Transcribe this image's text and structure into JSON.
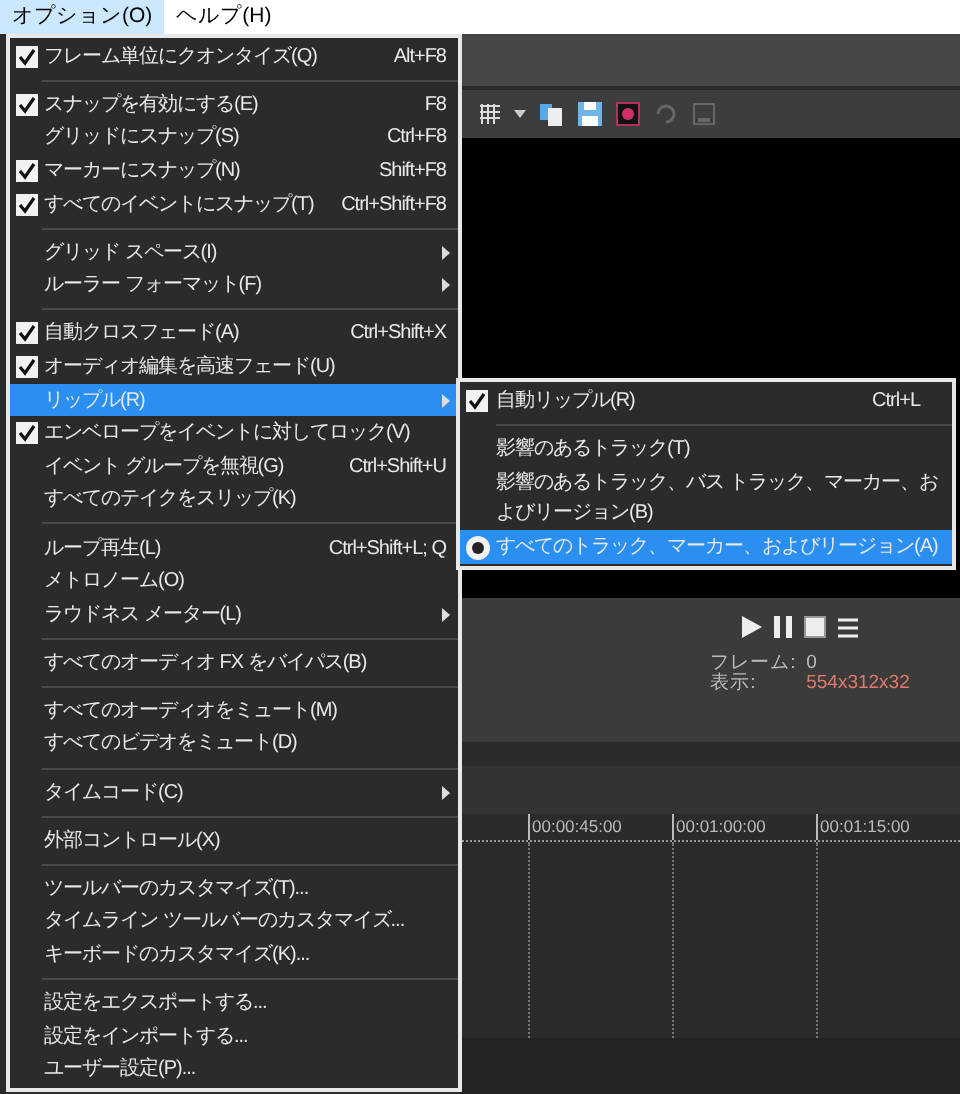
{
  "menubar": [
    {
      "label": "オプション(O)",
      "selected": true
    },
    {
      "label": "ヘルプ(H)",
      "selected": false
    }
  ],
  "menu": {
    "items": [
      {
        "kind": "item",
        "label": "フレーム単位にクオンタイズ(Q)",
        "shortcut": "Alt+F8",
        "checked": true,
        "highlighted": false
      },
      {
        "kind": "separator"
      },
      {
        "kind": "item",
        "label": "スナップを有効にする(E)",
        "shortcut": "F8",
        "checked": true,
        "highlighted": false
      },
      {
        "kind": "item",
        "label": "グリッドにスナップ(S)",
        "shortcut": "Ctrl+F8",
        "checked": false,
        "highlighted": false
      },
      {
        "kind": "item",
        "label": "マーカーにスナップ(N)",
        "shortcut": "Shift+F8",
        "checked": true,
        "highlighted": false
      },
      {
        "kind": "item",
        "label": "すべてのイベントにスナップ(T)",
        "shortcut": "Ctrl+Shift+F8",
        "checked": true,
        "highlighted": false
      },
      {
        "kind": "separator"
      },
      {
        "kind": "submenu",
        "label": "グリッド スペース(I)",
        "checked": false,
        "highlighted": false
      },
      {
        "kind": "submenu",
        "label": "ルーラー フォーマット(F)",
        "checked": false,
        "highlighted": false
      },
      {
        "kind": "separator"
      },
      {
        "kind": "item",
        "label": "自動クロスフェード(A)",
        "shortcut": "Ctrl+Shift+X",
        "checked": true,
        "highlighted": false
      },
      {
        "kind": "item",
        "label": "オーディオ編集を高速フェード(U)",
        "checked": true,
        "highlighted": false
      },
      {
        "kind": "submenu",
        "label": "リップル(R)",
        "checked": false,
        "highlighted": true
      },
      {
        "kind": "item",
        "label": "エンベロープをイベントに対してロック(V)",
        "checked": true,
        "highlighted": false
      },
      {
        "kind": "item",
        "label": "イベント グループを無視(G)",
        "shortcut": "Ctrl+Shift+U",
        "checked": false,
        "highlighted": false
      },
      {
        "kind": "item",
        "label": "すべてのテイクをスリップ(K)",
        "checked": false,
        "highlighted": false
      },
      {
        "kind": "separator"
      },
      {
        "kind": "item",
        "label": "ループ再生(L)",
        "shortcut": "Ctrl+Shift+L; Q",
        "checked": false,
        "highlighted": false
      },
      {
        "kind": "item",
        "label": "メトロノーム(O)",
        "checked": false,
        "highlighted": false
      },
      {
        "kind": "submenu",
        "label": "ラウドネス メーター(L)",
        "checked": false,
        "highlighted": false
      },
      {
        "kind": "separator"
      },
      {
        "kind": "item",
        "label": "すべてのオーディオ FX をバイパス(B)",
        "checked": false,
        "highlighted": false
      },
      {
        "kind": "separator"
      },
      {
        "kind": "item",
        "label": "すべてのオーディオをミュート(M)",
        "checked": false,
        "highlighted": false
      },
      {
        "kind": "item",
        "label": "すべてのビデオをミュート(D)",
        "checked": false,
        "highlighted": false
      },
      {
        "kind": "separator"
      },
      {
        "kind": "submenu",
        "label": "タイムコード(C)",
        "checked": false,
        "highlighted": false
      },
      {
        "kind": "separator"
      },
      {
        "kind": "item",
        "label": "外部コントロール(X)",
        "checked": false,
        "highlighted": false
      },
      {
        "kind": "separator"
      },
      {
        "kind": "item",
        "label": "ツールバーのカスタマイズ(T)...",
        "checked": false,
        "highlighted": false
      },
      {
        "kind": "item",
        "label": "タイムライン ツールバーのカスタマイズ...",
        "checked": false,
        "highlighted": false
      },
      {
        "kind": "item",
        "label": "キーボードのカスタマイズ(K)...",
        "checked": false,
        "highlighted": false
      },
      {
        "kind": "separator"
      },
      {
        "kind": "item",
        "label": "設定をエクスポートする...",
        "checked": false,
        "highlighted": false
      },
      {
        "kind": "item",
        "label": "設定をインポートする...",
        "checked": false,
        "highlighted": false
      },
      {
        "kind": "item",
        "label": "ユーザー設定(P)...",
        "checked": false,
        "highlighted": false
      }
    ]
  },
  "submenu": {
    "items": [
      {
        "kind": "check",
        "label": "自動リップル(R)",
        "shortcut": "Ctrl+L",
        "checked": true,
        "highlighted": false
      },
      {
        "kind": "separator"
      },
      {
        "kind": "radio",
        "label": "影響のあるトラック(T)",
        "selected": false,
        "highlighted": false
      },
      {
        "kind": "radio",
        "label": "影響のあるトラック、バス トラック、マーカー、およびリージョン(B)",
        "selected": false,
        "highlighted": false
      },
      {
        "kind": "radio",
        "label": "すべてのトラック、マーカー、およびリージョン(A)",
        "selected": true,
        "highlighted": true
      }
    ]
  },
  "transport": {
    "frame_label": "フレーム:",
    "frame_value": "0",
    "display_label": "表示:",
    "display_value": "554x312x32"
  },
  "timeline": {
    "ruler_labels": [
      "00:00:45:00",
      "00:01:00:00",
      "00:01:15:00"
    ]
  }
}
